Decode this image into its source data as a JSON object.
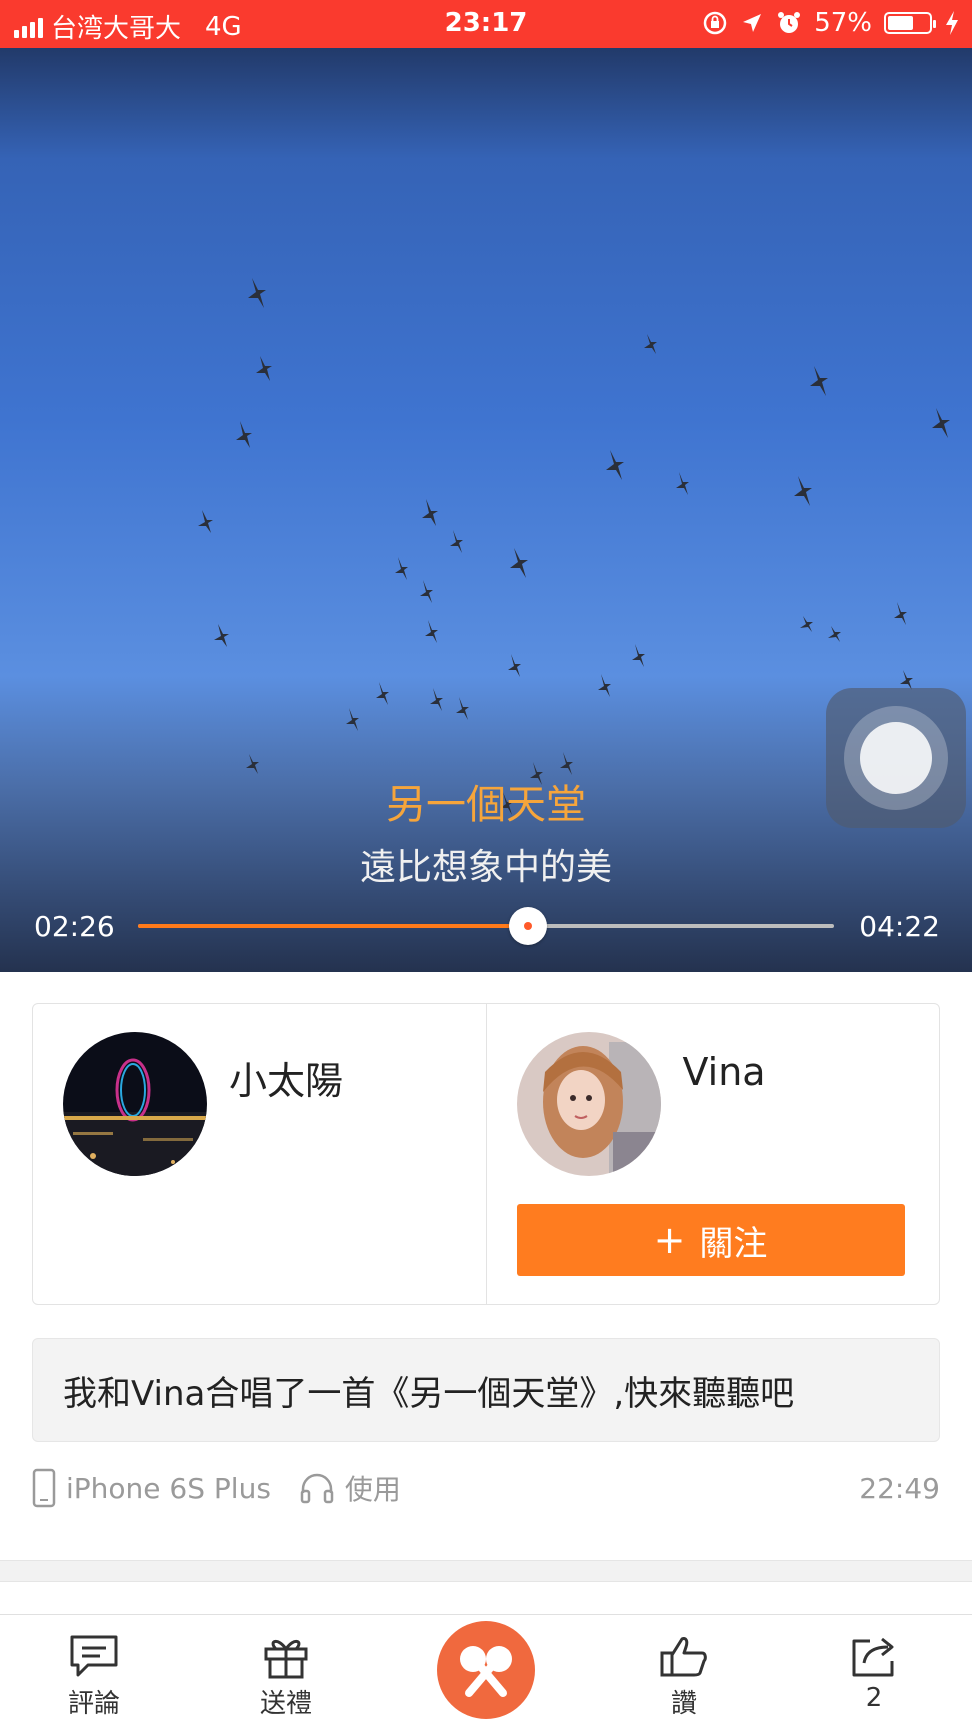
{
  "status_bar": {
    "carrier": "台湾大哥大",
    "network": "4G",
    "time": "23:17",
    "battery_percent": "57%",
    "battery_level": 0.57
  },
  "player": {
    "lyric_title": "另一個天堂",
    "lyric_line": "遠比想象中的美",
    "current_time": "02:26",
    "total_time": "04:22",
    "progress": 0.56,
    "lyric_color": "#f6a53b",
    "accent_color": "#ff7a1a"
  },
  "singers": [
    {
      "name": "小太陽"
    },
    {
      "name": "Vina",
      "follow_label": "關注"
    }
  ],
  "message": "我和Vina合唱了一首《另一個天堂》,快來聽聽吧",
  "meta": {
    "device": "iPhone 6S Plus",
    "usage": "使用",
    "time": "22:49"
  },
  "tabbar": {
    "comment": "評論",
    "gift": "送禮",
    "like": "讚",
    "share_count": "2"
  }
}
